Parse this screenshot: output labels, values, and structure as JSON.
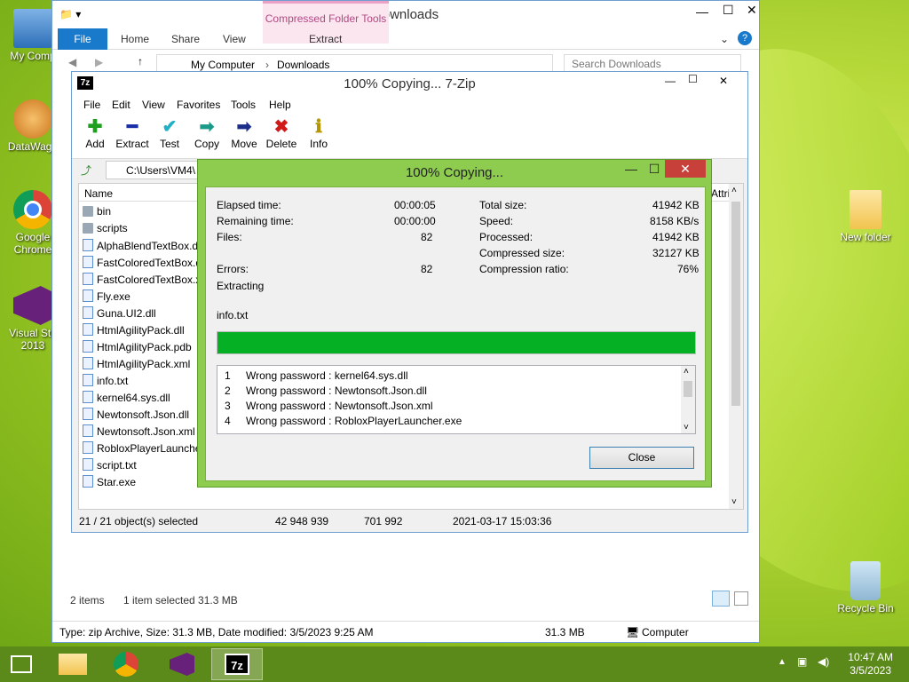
{
  "desktop": {
    "icons": [
      {
        "label": "My Comp"
      },
      {
        "label": "DataWago"
      },
      {
        "label": "Google Chrome"
      },
      {
        "label": "Visual Stu 2013"
      },
      {
        "label": "New folder"
      },
      {
        "label": "Recycle Bin"
      }
    ]
  },
  "explorer": {
    "title": "Downloads",
    "context_tab": "Compressed Folder Tools",
    "tabs": {
      "file": "File",
      "home": "Home",
      "share": "Share",
      "view": "View",
      "extract": "Extract"
    },
    "breadcrumb": {
      "root": "My Computer",
      "folder": "Downloads"
    },
    "search_placeholder": "Search Downloads",
    "status": {
      "items": "2 items",
      "selected": "1 item selected  31.3 MB"
    },
    "details": {
      "info": "Type: zip Archive, Size: 31.3 MB, Date modified: 3/5/2023 9:25 AM",
      "size": "31.3 MB",
      "location": "Computer"
    }
  },
  "sevenzip": {
    "title": "100% Copying... 7-Zip",
    "menu": [
      "File",
      "Edit",
      "View",
      "Favorites",
      "Tools",
      "Help"
    ],
    "toolbar": [
      "Add",
      "Extract",
      "Test",
      "Copy",
      "Move",
      "Delete",
      "Info"
    ],
    "path": "C:\\Users\\VM4\\",
    "header": {
      "name": "Name",
      "attrib": "Attrib"
    },
    "files": [
      {
        "name": "bin",
        "type": "folder"
      },
      {
        "name": "scripts",
        "type": "folder"
      },
      {
        "name": "AlphaBlendTextBox.dll",
        "type": "file"
      },
      {
        "name": "FastColoredTextBox.dll",
        "type": "file"
      },
      {
        "name": "FastColoredTextBox.xml",
        "type": "file"
      },
      {
        "name": "Fly.exe",
        "type": "file"
      },
      {
        "name": "Guna.UI2.dll",
        "type": "file"
      },
      {
        "name": "HtmlAgilityPack.dll",
        "type": "file"
      },
      {
        "name": "HtmlAgilityPack.pdb",
        "type": "file"
      },
      {
        "name": "HtmlAgilityPack.xml",
        "type": "file"
      },
      {
        "name": "info.txt",
        "type": "file"
      },
      {
        "name": "kernel64.sys.dll",
        "type": "file"
      },
      {
        "name": "Newtonsoft.Json.dll",
        "type": "file"
      },
      {
        "name": "Newtonsoft.Json.xml",
        "type": "file"
      },
      {
        "name": "RobloxPlayerLauncher.exe",
        "type": "file"
      },
      {
        "name": "script.txt",
        "type": "file"
      },
      {
        "name": "Star.exe",
        "type": "file"
      }
    ],
    "status": {
      "selected": "21 / 21 object(s) selected",
      "size": "42 948 939",
      "packed": "701 992",
      "date": "2021-03-17 15:03:36"
    }
  },
  "progress": {
    "title": "100% Copying...",
    "left": [
      {
        "label": "Elapsed time:",
        "value": "00:00:05"
      },
      {
        "label": "Remaining time:",
        "value": "00:00:00"
      },
      {
        "label": "Files:",
        "value": "82"
      },
      {
        "label": "Errors:",
        "value": "82"
      }
    ],
    "right": [
      {
        "label": "Total size:",
        "value": "41942 KB"
      },
      {
        "label": "Speed:",
        "value": "8158 KB/s"
      },
      {
        "label": "Processed:",
        "value": "41942 KB"
      },
      {
        "label": "Compressed size:",
        "value": "32127 KB"
      },
      {
        "label": "Compression ratio:",
        "value": "76%"
      }
    ],
    "action": "Extracting",
    "current_file": "info.txt",
    "percent": 100,
    "log": [
      {
        "n": "1",
        "msg": "Wrong password : kernel64.sys.dll"
      },
      {
        "n": "2",
        "msg": "Wrong password : Newtonsoft.Json.dll"
      },
      {
        "n": "3",
        "msg": "Wrong password : Newtonsoft.Json.xml"
      },
      {
        "n": "4",
        "msg": "Wrong password : RobloxPlayerLauncher.exe"
      }
    ],
    "close_label": "Close"
  },
  "taskbar": {
    "time": "10:47 AM",
    "date": "3/5/2023"
  },
  "colors": {
    "progress_fill": "#06b025",
    "dialog_frame": "#8dcc4e",
    "close_red": "#c7403a"
  }
}
